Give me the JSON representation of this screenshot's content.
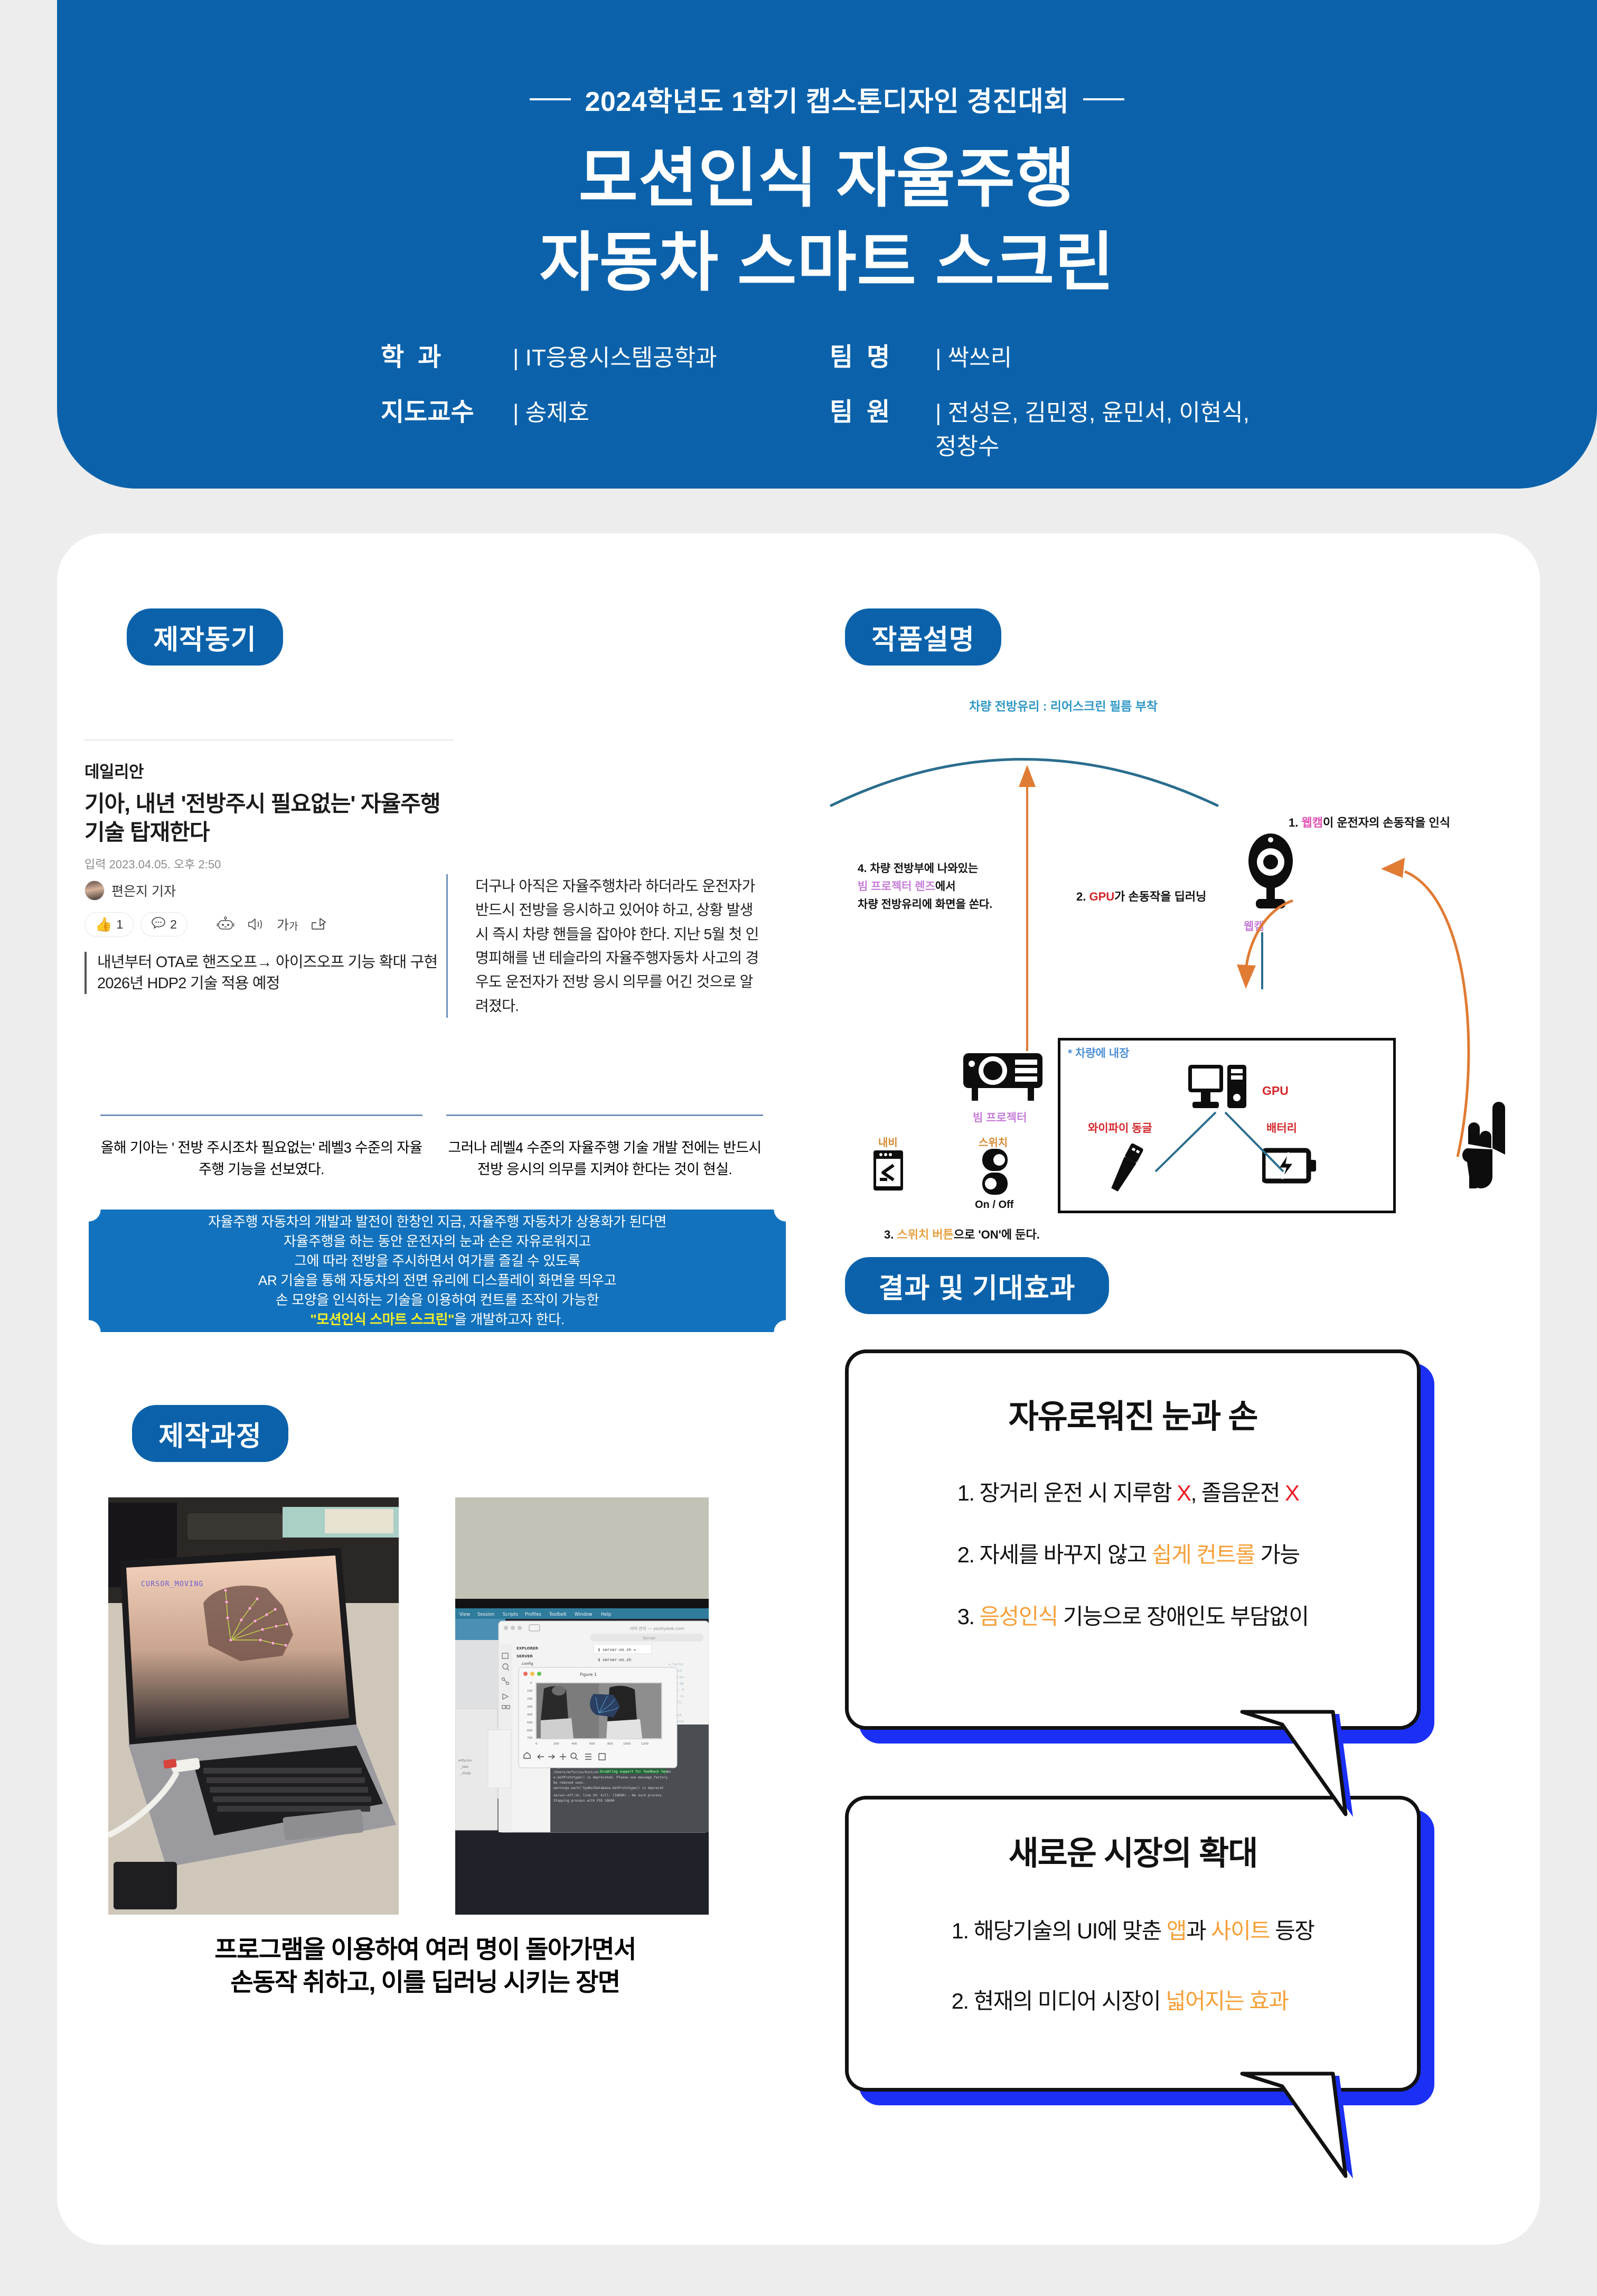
{
  "header": {
    "eyebrow": "2024학년도 1학기 캡스톤디자인 경진대회",
    "title_line1": "모션인식 자율주행",
    "title_line2": "자동차 스마트 스크린",
    "meta": [
      {
        "key": "학과",
        "value": "IT응용시스템공학과"
      },
      {
        "key": "팀명",
        "value": "싹쓰리"
      },
      {
        "key": "지도교수",
        "value": "송제호"
      },
      {
        "key": "팀원",
        "value": "전성은, 김민정, 윤민서, 이현식, 정창수"
      }
    ]
  },
  "sections": {
    "motivation": "제작동기",
    "description": "작품설명",
    "results": "결과 및 기대효과",
    "process": "제작과정"
  },
  "news": {
    "brand": "데일리안",
    "title": "기아, 내년 '전방주시 필요없는' 자율주행 기술 탑재한다",
    "date": "입력 2023.04.05. 오후 2:50",
    "author": "편은지 기자",
    "like_count": "1",
    "comment_count": "2",
    "quote_line1": "내년부터 OTA로 핸즈오프→ 아이즈오프 기능 확대 구현",
    "quote_line2": "2026년 HDP2 기술 적용 예정"
  },
  "motivation": {
    "col_right": "더구나 아직은 자율주행차라 하더라도 운전자가 반드시 전방을 응시하고 있어야 하고, 상황 발생 시 즉시 차량 핸들을 잡아야 한다. 지난 5월 첫 인명피해를 낸 테슬라의 자율주행자동차 사고의 경우도 운전자가 전방 응시 의무를 어긴 것으로 알려졌다.",
    "bottom_left": "올해 기아는 ' 전방 주시조차 필요없는' 레벨3 수준의 자율주행 기능을 선보였다.",
    "bottom_right": "그러나 레벨4 수준의 자율주행 기술 개발 전에는 반드시 전방 응시의 의무를 지켜야 한다는 것이 현실."
  },
  "banner": {
    "line1": "자율주행 자동차의 개발과 발전이 한창인 지금, 자율주행 자동차가 상용화가 된다면",
    "line2": "자율주행을 하는 동안 운전자의 눈과 손은 자유로워지고",
    "line3": "그에 따라 전방을 주시하면서 여가를 즐길 수 있도록",
    "line4": "AR 기술을 통해 자동차의 전면 유리에 디스플레이 화면을 띄우고",
    "line5": "손 모양을 인식하는 기술을 이용하여  컨트롤 조작이 가능한",
    "line6_highlight": "\"모션인식 스마트 스크린\"",
    "line6_rest": "을 개발하고자 한다."
  },
  "diagram": {
    "windshield_label": "차량 전방유리 : 리어스크린 필름 부착",
    "step1": {
      "num": "1.",
      "highlight": "웹캠",
      "rest": "이 운전자의 손동작을 인식"
    },
    "step2": {
      "num": "2.",
      "highlight": "GPU",
      "rest": "가 손동작을 딥러닝"
    },
    "step3": {
      "num": "3.",
      "highlight": "스위치 버튼",
      "rest": "으로 'ON'에 둔다."
    },
    "step4_l1": "4. 차량 전방부에 나와있는",
    "step4_l2": "빔 프로젝터 렌즈",
    "step4_l2b": "에서",
    "step4_l3": "차량 전방유리에 화면을 쏜다.",
    "embedded_note": "* 차량에 내장",
    "labels": {
      "webcam": "웹캠",
      "gpu": "GPU",
      "projector": "빔 프로젝터",
      "nav": "내비",
      "switch": "스위치",
      "switch_onoff": "On / Off",
      "wifi": "와이파이 동글",
      "battery": "배터리"
    }
  },
  "process": {
    "photo1_overlay": "CURSOR_MOVING",
    "caption_line1": "프로그램을 이용하여 여러 명이 돌아가면서",
    "caption_line2": "손동작 취하고, 이를 딥러닝 시키는 장면"
  },
  "results": {
    "bubble1": {
      "title": "자유로워진 눈과 손",
      "items": [
        {
          "num": "1. ",
          "a": "장거리 운전 시 지루함 ",
          "mark": "X",
          "b": ", 졸음운전 ",
          "mark2": "X",
          "c": ""
        },
        {
          "num": "2. ",
          "a": "자세를 바꾸지 않고 ",
          "hl": "쉽게 컨트롤",
          "b": " 가능"
        },
        {
          "num": "3. ",
          "hl": "음성인식",
          "b": " 기능으로 장애인도 부담없이"
        }
      ]
    },
    "bubble2": {
      "title": "새로운 시장의 확대",
      "items": [
        {
          "num": "1. ",
          "a": "해당기술의 UI에 맞춘 ",
          "hl": "앱",
          "b": "과 ",
          "hl2": "사이트",
          "c": " 등장"
        },
        {
          "num": "2. ",
          "a": "현재의 미디어 시장이 ",
          "hl": "넓어지는 효과"
        }
      ]
    }
  },
  "colors": {
    "brand_blue": "#0b62ab",
    "banner_blue": "#1272bd",
    "bubble_shadow": "#1b2ff5",
    "accent_orange": "#f6a03a",
    "accent_red": "#ec1c24",
    "highlight_yellow": "#f7f12a",
    "page_bg": "#ededed"
  }
}
